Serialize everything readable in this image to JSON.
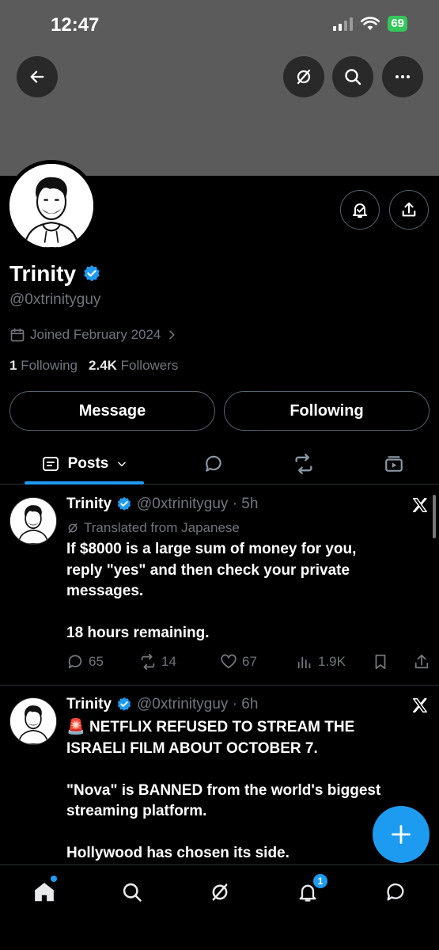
{
  "status_bar": {
    "time": "12:47",
    "battery": "69"
  },
  "profile": {
    "name": "Trinity",
    "handle": "@0xtrinityguy",
    "joined": "Joined February 2024",
    "following_count": "1",
    "following_label": "Following",
    "followers_count": "2.4K",
    "followers_label": "Followers",
    "message_button": "Message",
    "following_button": "Following"
  },
  "tabs": {
    "posts_label": "Posts"
  },
  "posts": [
    {
      "name": "Trinity",
      "meta": "@0xtrinityguy · 5h",
      "translated": "Translated from Japanese",
      "lines": [
        "If $8000 is a large sum of money for you,",
        "reply \"yes\" and then check your private",
        "messages.",
        "",
        "18 hours remaining."
      ],
      "replies": "65",
      "reposts": "14",
      "likes": "67",
      "views": "1.9K"
    },
    {
      "name": "Trinity",
      "meta": "@0xtrinityguy · 6h",
      "emoji": "🚨",
      "lines": [
        "NETFLIX REFUSED TO STREAM THE",
        "ISRAELI FILM ABOUT OCTOBER 7.",
        "",
        "\"Nova\" is BANNED from the world's biggest",
        "streaming platform.",
        "",
        "Hollywood has chosen its side."
      ]
    }
  ],
  "bottom_nav": {
    "notifications_badge": "1"
  },
  "colors": {
    "accent": "#1d9bf0",
    "banner": "#5b5b5b",
    "muted_text": "#71767b",
    "border": "#2f3336"
  }
}
